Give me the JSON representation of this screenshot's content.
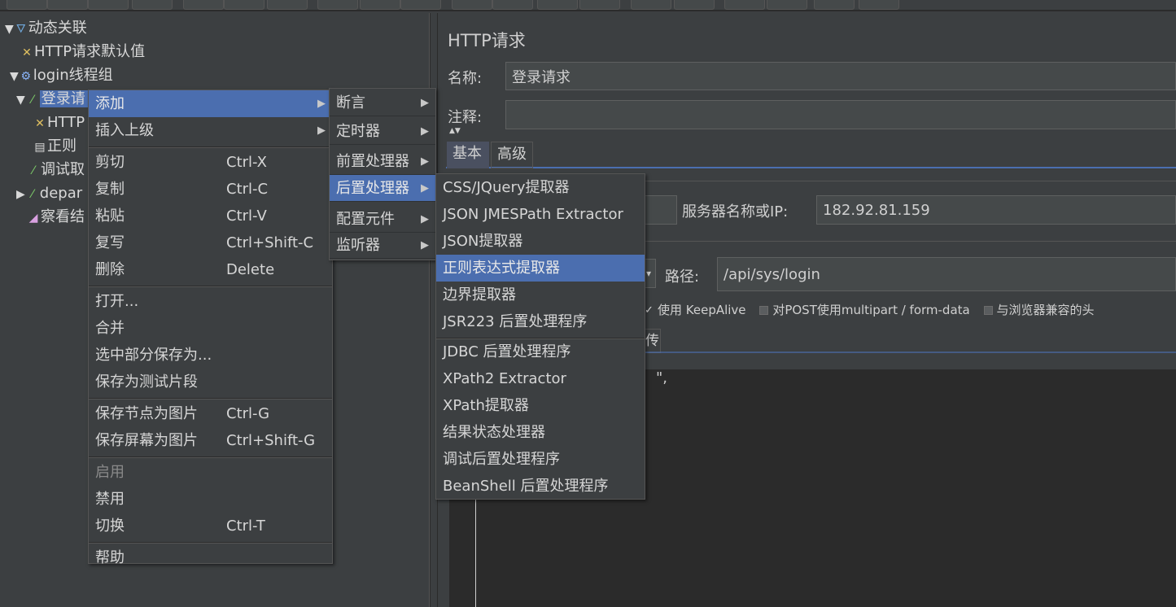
{
  "tree": [
    {
      "label": "动态关联",
      "icon": "flask-icon",
      "expander": "▼"
    },
    {
      "label": "HTTP请求默认值",
      "icon": "tools-icon",
      "expander": ""
    },
    {
      "label": "login线程组",
      "icon": "gear-icon",
      "expander": "▼"
    },
    {
      "label": "登录请",
      "icon": "pipette-icon",
      "expander": "▼",
      "selected": true
    },
    {
      "label": "HTTP",
      "icon": "tools-icon",
      "expander": ""
    },
    {
      "label": "正则",
      "icon": "document-icon",
      "expander": ""
    },
    {
      "label": "调试取",
      "icon": "pipette-icon",
      "expander": ""
    },
    {
      "label": "depar",
      "icon": "pipette-icon",
      "expander": "▶"
    },
    {
      "label": "察看结",
      "icon": "chart-icon",
      "expander": ""
    }
  ],
  "context_menu": {
    "items": [
      {
        "label": "添加",
        "submenu": true,
        "highlighted": true
      },
      {
        "label": "插入上级",
        "submenu": true
      },
      {
        "sep": true
      },
      {
        "label": "剪切",
        "shortcut": "Ctrl-X"
      },
      {
        "label": "复制",
        "shortcut": "Ctrl-C"
      },
      {
        "label": "粘贴",
        "shortcut": "Ctrl-V"
      },
      {
        "label": "复写",
        "shortcut": "Ctrl+Shift-C"
      },
      {
        "label": "删除",
        "shortcut": "Delete"
      },
      {
        "sep": true
      },
      {
        "label": "打开..."
      },
      {
        "label": "合并"
      },
      {
        "label": "选中部分保存为..."
      },
      {
        "label": "保存为测试片段"
      },
      {
        "sep": true
      },
      {
        "label": "保存节点为图片",
        "shortcut": "Ctrl-G"
      },
      {
        "label": "保存屏幕为图片",
        "shortcut": "Ctrl+Shift-G"
      },
      {
        "sep": true
      },
      {
        "label": "启用",
        "disabled": true
      },
      {
        "label": "禁用"
      },
      {
        "label": "切换",
        "shortcut": "Ctrl-T"
      },
      {
        "sep": true
      },
      {
        "label": "帮助"
      }
    ]
  },
  "add_submenu": {
    "items": [
      {
        "label": "断言",
        "submenu": true
      },
      {
        "label": "定时器",
        "submenu": true
      },
      {
        "label": "前置处理器",
        "submenu": true
      },
      {
        "label": "后置处理器",
        "submenu": true,
        "highlighted": true
      },
      {
        "label": "配置元件",
        "submenu": true
      },
      {
        "label": "监听器",
        "submenu": true
      }
    ]
  },
  "post_processor_submenu": {
    "items": [
      {
        "label": "CSS/JQuery提取器"
      },
      {
        "label": "JSON JMESPath Extractor"
      },
      {
        "label": "JSON提取器"
      },
      {
        "label": "正则表达式提取器",
        "highlighted": true
      },
      {
        "label": "边界提取器"
      },
      {
        "label": "JSR223 后置处理程序"
      },
      {
        "sep": true
      },
      {
        "label": "JDBC 后置处理程序"
      },
      {
        "label": "XPath2 Extractor"
      },
      {
        "label": "XPath提取器"
      },
      {
        "label": "结果状态处理器"
      },
      {
        "label": "调试后置处理程序"
      },
      {
        "label": "BeanShell 后置处理程序"
      }
    ]
  },
  "panel": {
    "title": "HTTP请求",
    "name_label": "名称:",
    "name_value": "登录请求",
    "comment_label": "注释:",
    "comment_value": "",
    "tabs": [
      "基本",
      "高级"
    ],
    "server_label": "服务器名称或IP:",
    "server_value": "182.92.81.159",
    "path_label": "路径:",
    "path_value": "/api/sys/login",
    "checkboxes": [
      {
        "label": "使用 KeepAlive",
        "checked": true
      },
      {
        "label": "对POST使用multipart / form-data",
        "checked": false
      },
      {
        "label": "与浏览器兼容的头",
        "checked": false
      }
    ],
    "partial_tab": "传",
    "editor_fragment": "\","
  },
  "colors": {
    "highlight": "#4b6eaf",
    "background": "#3c3f41",
    "editor": "#2b2b2b"
  }
}
